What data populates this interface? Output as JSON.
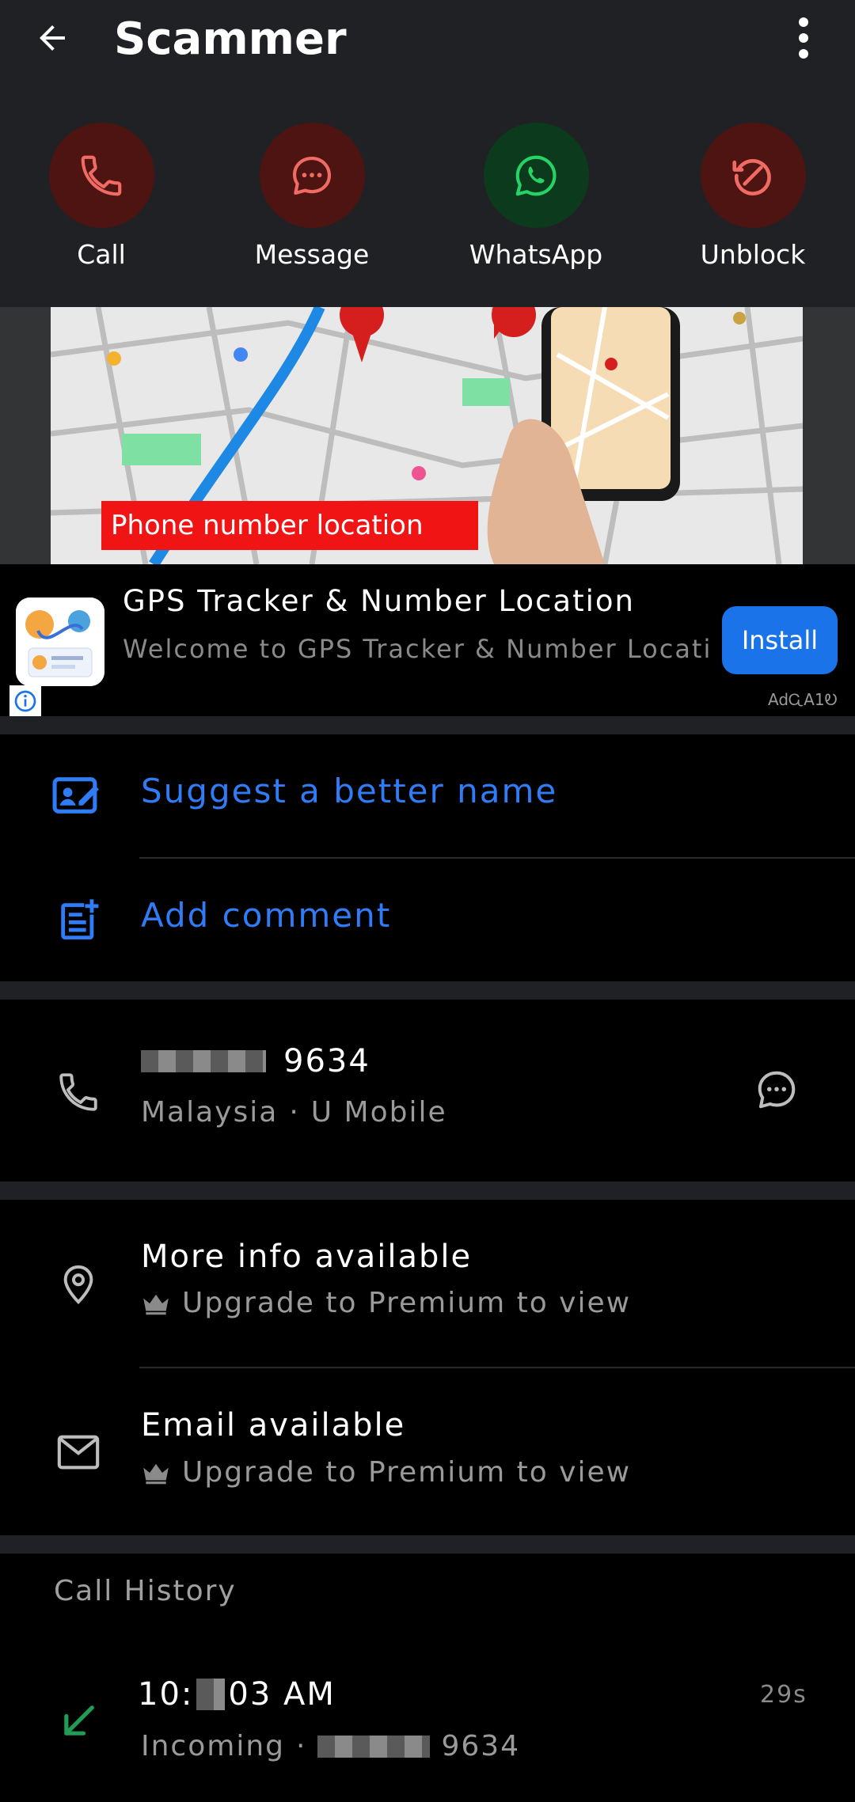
{
  "header": {
    "title": "Scammer",
    "actions": [
      {
        "label": "Call",
        "icon": "phone-icon",
        "color": "#ef6b63"
      },
      {
        "label": "Message",
        "icon": "message-icon",
        "color": "#ef6b63"
      },
      {
        "label": "WhatsApp",
        "icon": "whatsapp-icon",
        "color": "#25d366"
      },
      {
        "label": "Unblock",
        "icon": "unblock-icon",
        "color": "#ef6b63"
      }
    ]
  },
  "ad": {
    "image_caption": "Phone number location",
    "title": "GPS Tracker & Number Location",
    "description": "Welcome to GPS Tracker & Number Location app, where you can securely ...",
    "install_label": "Install",
    "tag": "AdᏩA1Ꭷ"
  },
  "actions_list": {
    "suggest_name": "Suggest a better name",
    "add_comment": "Add comment"
  },
  "number": {
    "suffix": "9634",
    "country": "Malaysia",
    "separator": "·",
    "carrier": "U Mobile"
  },
  "more_info": {
    "title": "More info available",
    "upgrade": "Upgrade to Premium to view"
  },
  "email": {
    "title": "Email available",
    "upgrade": "Upgrade to Premium to view"
  },
  "call_history": {
    "title": "Call History",
    "entries": [
      {
        "time_prefix": "10:",
        "time_suffix": "03 AM",
        "type": "Incoming",
        "separator": "·",
        "number_suffix": "9634",
        "duration": "29s"
      }
    ]
  },
  "colors": {
    "accent_blue": "#2f7cf6",
    "header_bg": "#202124",
    "incoming_green": "#1f9d55"
  }
}
